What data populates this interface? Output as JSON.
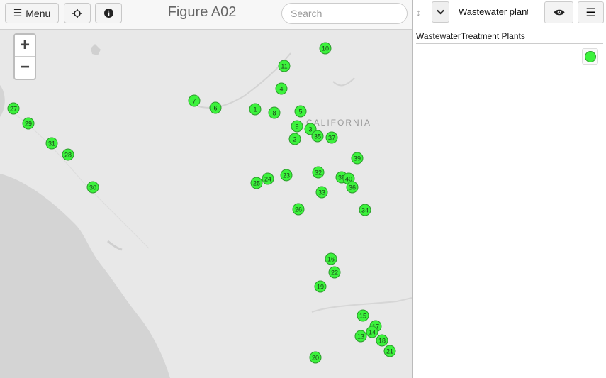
{
  "toolbar": {
    "menu_label": "Menu",
    "menu_icon": "hamburger-icon",
    "locate_icon": "crosshair-icon",
    "info_icon": "info-icon",
    "title": "Figure A02",
    "search_placeholder": "Search"
  },
  "map": {
    "zoom_in": "+",
    "zoom_out": "−",
    "state_label": "CALIFORNIA",
    "marker_color": "#3cf23c",
    "markers": [
      "10",
      "11",
      "4",
      "7",
      "6",
      "1",
      "8",
      "5",
      "9",
      "3",
      "35",
      "37",
      "2",
      "27",
      "29",
      "31",
      "28",
      "39",
      "24",
      "23",
      "32",
      "38",
      "40",
      "25",
      "36",
      "33",
      "30",
      "34",
      "26",
      "16",
      "22",
      "19",
      "15",
      "17",
      "14",
      "13",
      "18",
      "21",
      "20"
    ]
  },
  "panel": {
    "drag_icon": "drag-handle-icon",
    "dropdown_icon": "chevron-down-icon",
    "layer_name": "Wastewater plants",
    "visibility_icon": "eye-icon",
    "options_icon": "list-icon",
    "legend_title": "WastewaterTreatment Plants",
    "legend_symbol_color": "#3cf23c"
  }
}
